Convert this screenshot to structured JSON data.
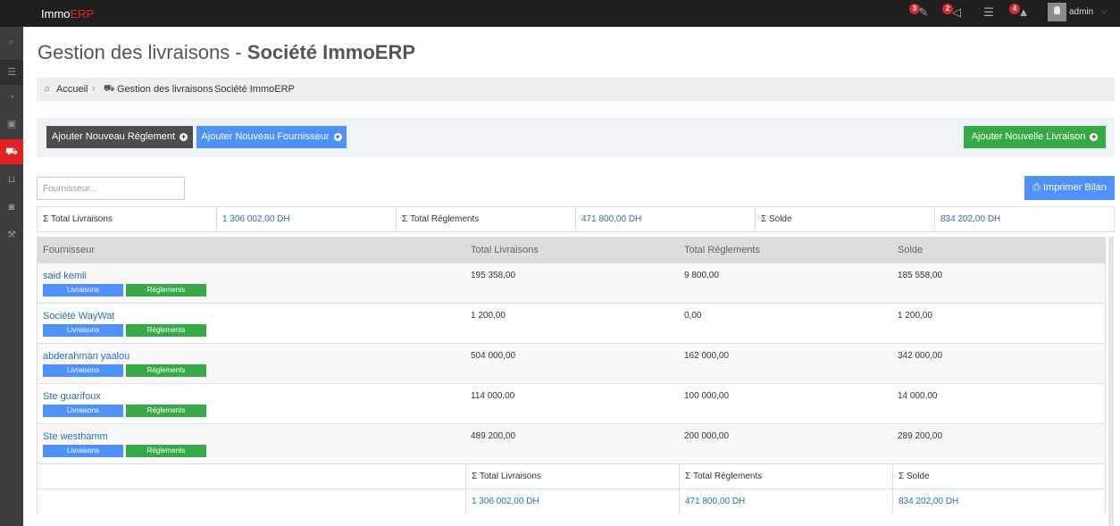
{
  "app": {
    "logo_main": "Immo",
    "logo_accent": "ERP"
  },
  "topbar": {
    "icons": [
      {
        "name": "tasks-icon",
        "glyph": "✎",
        "badge": "3"
      },
      {
        "name": "announcement-icon",
        "glyph": "◁",
        "badge": "2"
      },
      {
        "name": "list-icon",
        "glyph": "☰",
        "badge": ""
      },
      {
        "name": "warning-icon",
        "glyph": "▲",
        "badge": "4"
      }
    ],
    "user": {
      "name": "admin",
      "caret": "⌵"
    }
  },
  "sidebar": {
    "items": [
      {
        "name": "search-icon",
        "glyph": "⌕"
      },
      {
        "name": "menu-icon",
        "glyph": "☰"
      },
      {
        "name": "dashboard-icon",
        "glyph": "◔"
      },
      {
        "name": "briefcase-icon",
        "glyph": "▣"
      },
      {
        "name": "truck-icon",
        "glyph": "⛟"
      },
      {
        "name": "cart-icon",
        "glyph": "⊔"
      },
      {
        "name": "money-icon",
        "glyph": "◙"
      },
      {
        "name": "wrench-icon",
        "glyph": "⚒"
      }
    ]
  },
  "page": {
    "title_light": "Gestion des livraisons - ",
    "title_bold": "Société ImmoERP"
  },
  "breadcrumb": {
    "home_label": "Accueil",
    "sep": "›",
    "section_label": "Gestion des livraisons",
    "current_label": "Société ImmoERP"
  },
  "actions": {
    "add_payment": "Ajouter Nouveau Réglement",
    "add_supplier": "Ajouter Nouveau Fournisseur",
    "add_delivery": "Ajouter Nouvelle Livraison",
    "plus": "+"
  },
  "search": {
    "placeholder": "Fournisseur..."
  },
  "print": {
    "label": "Imprimer Bilan",
    "icon": "⎙"
  },
  "summary": {
    "total_deliveries_label": "Σ Total Livraisons",
    "total_deliveries_value": "1 306 002,00 DH",
    "total_payments_label": "Σ Total Réglements",
    "total_payments_value": "471 800,00 DH",
    "balance_label": "Σ Solde",
    "balance_value": "834 202,00 DH"
  },
  "table": {
    "headers": [
      "Fournisseur",
      "Total Livraisons",
      "Total Réglements",
      "Solde"
    ],
    "tag_deliveries": "Livraisons",
    "tag_payments": "Réglements",
    "rows": [
      {
        "name": "said kemli",
        "deliveries": "195 358,00",
        "payments": "9 800,00",
        "balance": "185 558,00"
      },
      {
        "name": "Société WayWat",
        "deliveries": "1 200,00",
        "payments": "0,00",
        "balance": "1 200,00"
      },
      {
        "name": "abderahman yaalou",
        "deliveries": "504 000,00",
        "payments": "162 000,00",
        "balance": "342 000,00"
      },
      {
        "name": "Ste guarifoux",
        "deliveries": "114 000,00",
        "payments": "100 000,00",
        "balance": "14 000,00"
      },
      {
        "name": "Ste westhamm",
        "deliveries": "489 200,00",
        "payments": "200 000,00",
        "balance": "289 200,00"
      }
    ],
    "footer": {
      "deliveries_label": "Σ Total Livraisons",
      "payments_label": "Σ Total Réglements",
      "balance_label": "Σ Solde",
      "deliveries_value": "1 306 002,00 DH",
      "payments_value": "471 800,00 DH",
      "balance_value": "834 202,00 DH"
    }
  }
}
